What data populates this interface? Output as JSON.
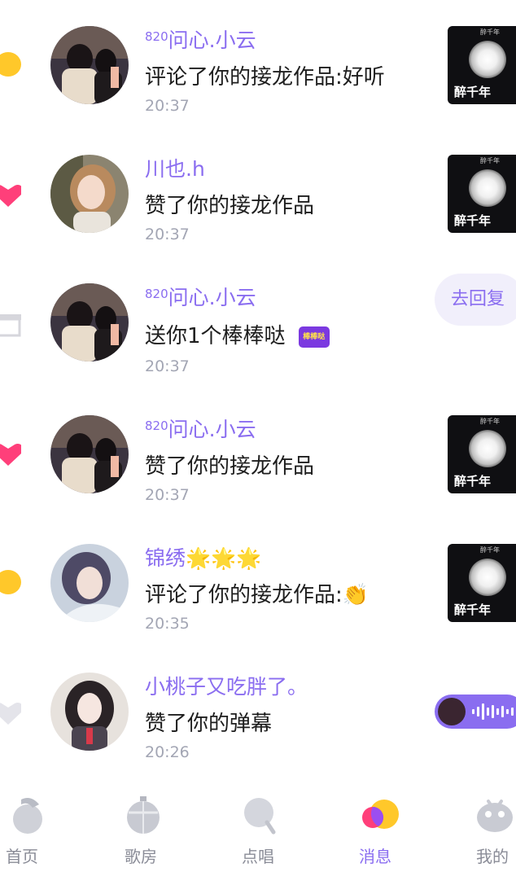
{
  "notifications": [
    {
      "user": "问心.小云",
      "user_prefix": "820",
      "action": "评论了你的接龙作品:好听",
      "time": "20:37",
      "right": "thumbnail",
      "lead_icon": "yellow-comment-icon"
    },
    {
      "user": "川也.h",
      "user_prefix": "",
      "action": "赞了你的接龙作品",
      "time": "20:37",
      "right": "thumbnail",
      "lead_icon": "heart-icon"
    },
    {
      "user": "问心.小云",
      "user_prefix": "820",
      "action": "送你1个棒棒哒",
      "time": "20:37",
      "right": "reply-button",
      "lead_icon": "gift-icon"
    },
    {
      "user": "问心.小云",
      "user_prefix": "820",
      "action": "赞了你的接龙作品",
      "time": "20:37",
      "right": "thumbnail",
      "lead_icon": "heart-icon"
    },
    {
      "user": "锦绣🌟🌟🌟",
      "user_prefix": "",
      "action": "评论了你的接龙作品:👏",
      "time": "20:35",
      "right": "thumbnail",
      "lead_icon": "yellow-comment-icon"
    },
    {
      "user": "小桃子又吃胖了。",
      "user_prefix": "",
      "action": "赞了你的弹幕",
      "time": "20:26",
      "right": "voice-pill",
      "lead_icon": "grey-heart-icon"
    }
  ],
  "thumbnail": {
    "title": "醉千年",
    "small": "醉千年"
  },
  "reply_button": "去回复",
  "gift_badge_text": "棒棒哒",
  "tabs": [
    {
      "label": "首页",
      "icon": "home-icon",
      "active": false
    },
    {
      "label": "歌房",
      "icon": "disco-ball-icon",
      "active": false
    },
    {
      "label": "点唱",
      "icon": "microphone-icon",
      "active": false
    },
    {
      "label": "消息",
      "icon": "message-bubbles-icon",
      "active": true
    },
    {
      "label": "我的",
      "icon": "profile-icon",
      "active": false
    }
  ],
  "colors": {
    "accent": "#8a6df0",
    "heart": "#ff3f7a",
    "yellow": "#ffc82a",
    "time": "#a3a6b4"
  }
}
